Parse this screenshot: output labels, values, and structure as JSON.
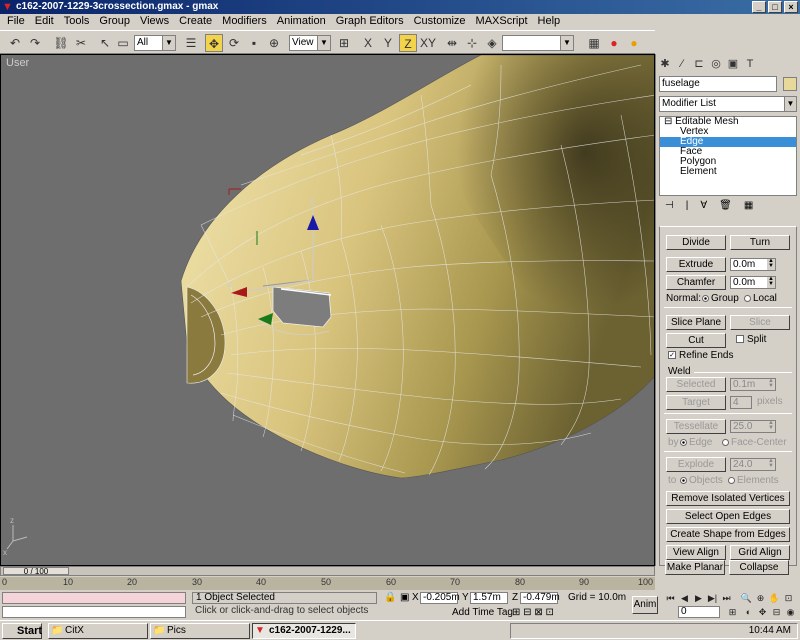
{
  "window": {
    "title": "c162-2007-1229-3crossection.gmax - gmax"
  },
  "menu": [
    "File",
    "Edit",
    "Tools",
    "Group",
    "Views",
    "Create",
    "Modifiers",
    "Animation",
    "Graph Editors",
    "Customize",
    "MAXScript",
    "Help"
  ],
  "toolbar": {
    "selection_filter": "All",
    "ref_coord": "View",
    "named_sel": ""
  },
  "viewport": {
    "label": "User"
  },
  "cmd_panel": {
    "object_name": "fuselage",
    "modifier_list": "Modifier List",
    "stack": [
      "Editable Mesh",
      "Vertex",
      "Edge",
      "Face",
      "Polygon",
      "Element"
    ],
    "buttons": {
      "divide": "Divide",
      "turn": "Turn",
      "extrude": "Extrude",
      "chamfer": "Chamfer",
      "slice_plane": "Slice Plane",
      "slice": "Slice",
      "cut": "Cut",
      "selected": "Selected",
      "target": "Target",
      "tessellate": "Tessellate",
      "explode": "Explode",
      "remove_isolated": "Remove Isolated Vertices",
      "select_open_edges": "Select Open Edges",
      "create_shape": "Create Shape from Edges",
      "view_align": "View Align",
      "grid_align": "Grid Align",
      "make_planar": "Make Planar",
      "collapse": "Collapse"
    },
    "labels": {
      "normal": "Normal:",
      "group": "Group",
      "local": "Local",
      "split": "Split",
      "refine_ends": "Refine Ends",
      "weld": "Weld",
      "pixels": "pixels",
      "by": "by",
      "edge": "Edge",
      "face_center": "Face-Center",
      "to": "to",
      "objects": "Objects",
      "elements": "Elements"
    },
    "values": {
      "extrude": "0.0m",
      "chamfer": "0.0m",
      "weld_sel": "0.1m",
      "weld_target": "4",
      "tessellate": "25.0",
      "explode": "24.0"
    }
  },
  "timeline": {
    "frame": "0 / 100",
    "ticks": [
      "0",
      "10",
      "20",
      "30",
      "40",
      "50",
      "60",
      "70",
      "80",
      "90",
      "100"
    ]
  },
  "status": {
    "selected": "1 Object Selected",
    "prompt": "Click or click-and-drag to select objects",
    "x": "-0.205m",
    "y": "1.57m",
    "z": "-0.479m",
    "grid": "Grid = 10.0m",
    "add_time_tag": "Add Time Tag",
    "anim": "Anim",
    "frame_field": "0"
  },
  "taskbar": {
    "start": "Start",
    "tasks": [
      "CitX",
      "Pics",
      "c162-2007-1229..."
    ],
    "clock": "10:44 AM"
  }
}
